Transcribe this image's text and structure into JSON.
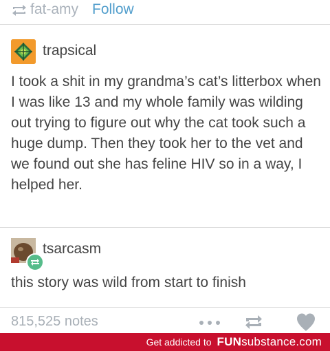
{
  "header": {
    "reblog_icon": "reblog-icon",
    "username": "fat-amy",
    "follow_label": "Follow"
  },
  "post": {
    "author": "trapsical",
    "avatar_color": "#f29a2c",
    "text": "I took a shit in my grandma’s cat’s litterbox when I was like 13 and my whole family was wilding out trying to figure out why the cat took such a huge dump. Then they took her to the vet and we found out she has feline HIV so in a way, I helped her."
  },
  "reply": {
    "author": "tsarcasm",
    "reblog_badge_color": "#56bc8a",
    "text": "this story was wild from start to finish"
  },
  "footer": {
    "notes": "815,525 notes",
    "icons": [
      "more-icon",
      "reblog-icon",
      "heart-icon"
    ]
  },
  "banner": {
    "tagline": "Get addicted to",
    "brand_bold": "FUN",
    "brand_light": "substance",
    "brand_tld": ".com",
    "color": "#c8102e"
  }
}
